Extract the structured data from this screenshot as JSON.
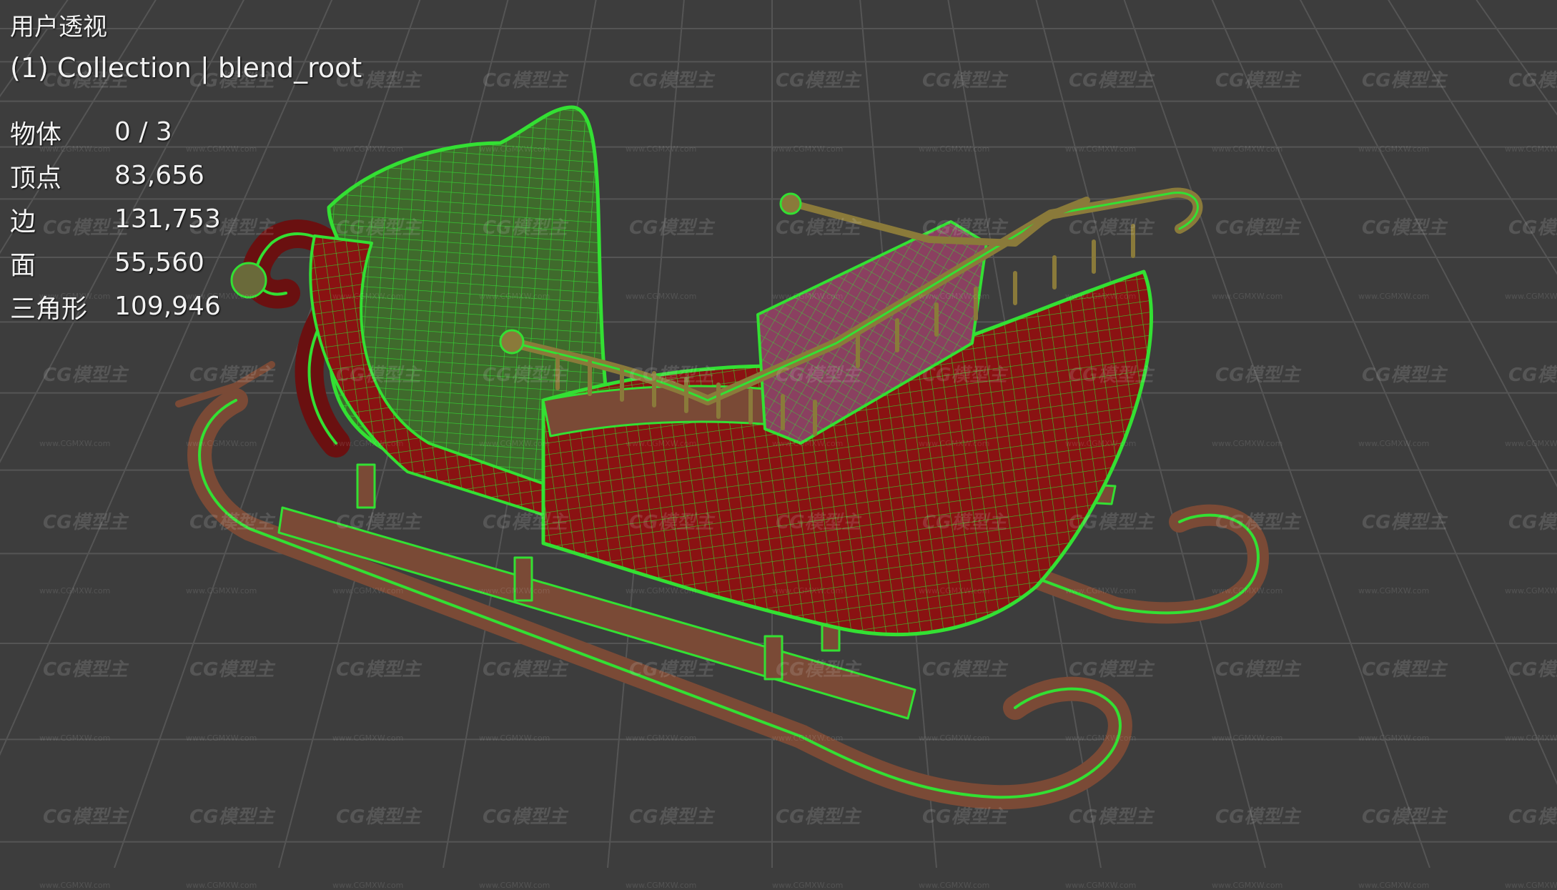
{
  "viewport": {
    "view_name": "用户透视",
    "collection_label": "(1) Collection | blend_root"
  },
  "stats": [
    {
      "label": "物体",
      "value": "0 / 3"
    },
    {
      "label": "顶点",
      "value": "83,656"
    },
    {
      "label": "边",
      "value": "131,753"
    },
    {
      "label": "面",
      "value": "55,560"
    },
    {
      "label": "三角形",
      "value": "109,946"
    }
  ],
  "watermark": {
    "logo_text": "CG模型主",
    "url_text": "www.CGMXW.com"
  },
  "colors": {
    "background": "#3d3d3d",
    "grid": "#555555",
    "wire": "#33e033",
    "body_red": "#8a1212",
    "runner": "#7a4a36",
    "seat": "#8a4060",
    "text": "#f2f2f2"
  }
}
